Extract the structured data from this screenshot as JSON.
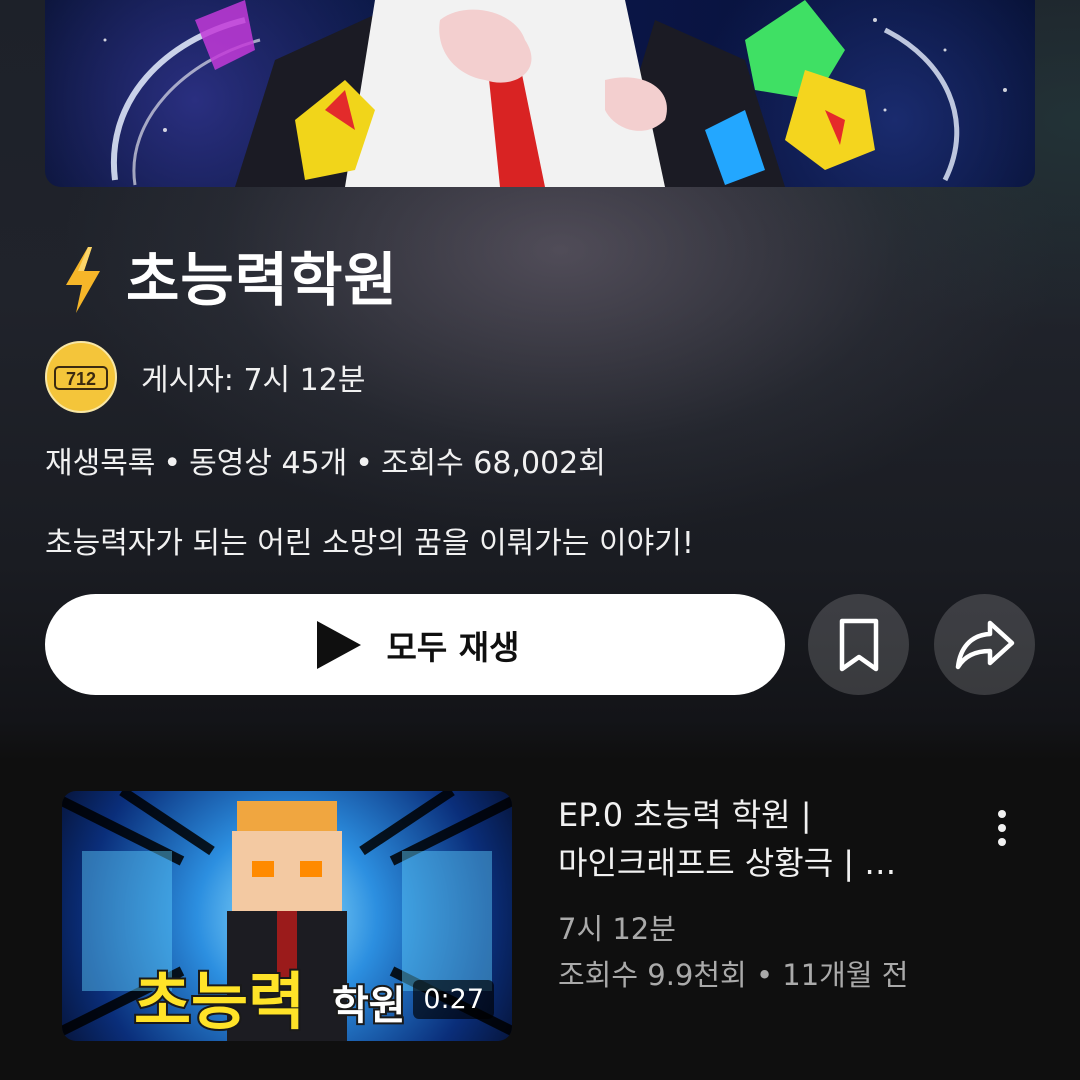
{
  "playlist": {
    "title": "초능력학원",
    "title_icon": "lightning-bolt-icon",
    "author_prefix": "게시자: 7시 12분",
    "avatar_text": "712",
    "meta": {
      "type": "재생목록",
      "videos": "동영상 45개",
      "views": "조회수 68,002회"
    },
    "description": "초능력자가 되는 어린 소망의 꿈을 이뤄가는 이야기!"
  },
  "actions": {
    "play_all_label": "모두 재생",
    "play_icon": "play-icon",
    "save_icon": "bookmark-icon",
    "share_icon": "share-icon"
  },
  "videos": [
    {
      "title_line1": "EP.0 초능력 학원 |",
      "title_line2": "마인크래프트 상황극 | …",
      "channel": "7시 12분",
      "stats": "조회수 9.9천회 • 11개월 전",
      "duration": "0:27",
      "thumb_text_1": "초능력",
      "thumb_text_2": "학원"
    }
  ],
  "colors": {
    "background": "#0f0f0f",
    "button_bg": "#ffffff",
    "secondary_text": "#aaaaaa",
    "bolt": "#f6b629"
  }
}
